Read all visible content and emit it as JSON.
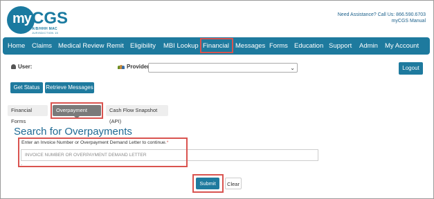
{
  "header": {
    "logo_my": "my",
    "logo_cgs": "CGS",
    "logo_line1": "A/B/HHH MAC",
    "logo_line2": "JURISDICTION 15",
    "assistance": "Need Assistance? Call Us: 866.590.6703",
    "manual": "myCGS Manual"
  },
  "nav": {
    "items": [
      "Home",
      "Claims",
      "Medical Review",
      "Remit",
      "Eligibility",
      "MBI Lookup",
      "Financial",
      "Messages",
      "Forms",
      "Education",
      "Support",
      "Admin",
      "My Account"
    ],
    "active": "Financial"
  },
  "account": {
    "user_label": "User:",
    "provider_label": "Provider:",
    "provider_value": "",
    "logout": "Logout"
  },
  "actions": {
    "get_status": "Get Status",
    "retrieve_messages": "Retrieve Messages"
  },
  "tabs": [
    "Financial Forms",
    "Overpayment Data",
    "Cash Flow Snapshot (API)"
  ],
  "active_tab": "Overpayment Data",
  "form": {
    "title": "Search for Overpayments",
    "instruction": "Enter an Invoice Number or Overpayment Demand Letter to continue.",
    "required_mark": "*",
    "placeholder": "INVOICE NUMBER OR OVERPAYMENT DEMAND LETTER",
    "submit": "Submit",
    "clear": "Clear"
  },
  "colors": {
    "brand": "#1e7a9e",
    "highlight": "#d9534f",
    "title": "#1e6a94"
  }
}
